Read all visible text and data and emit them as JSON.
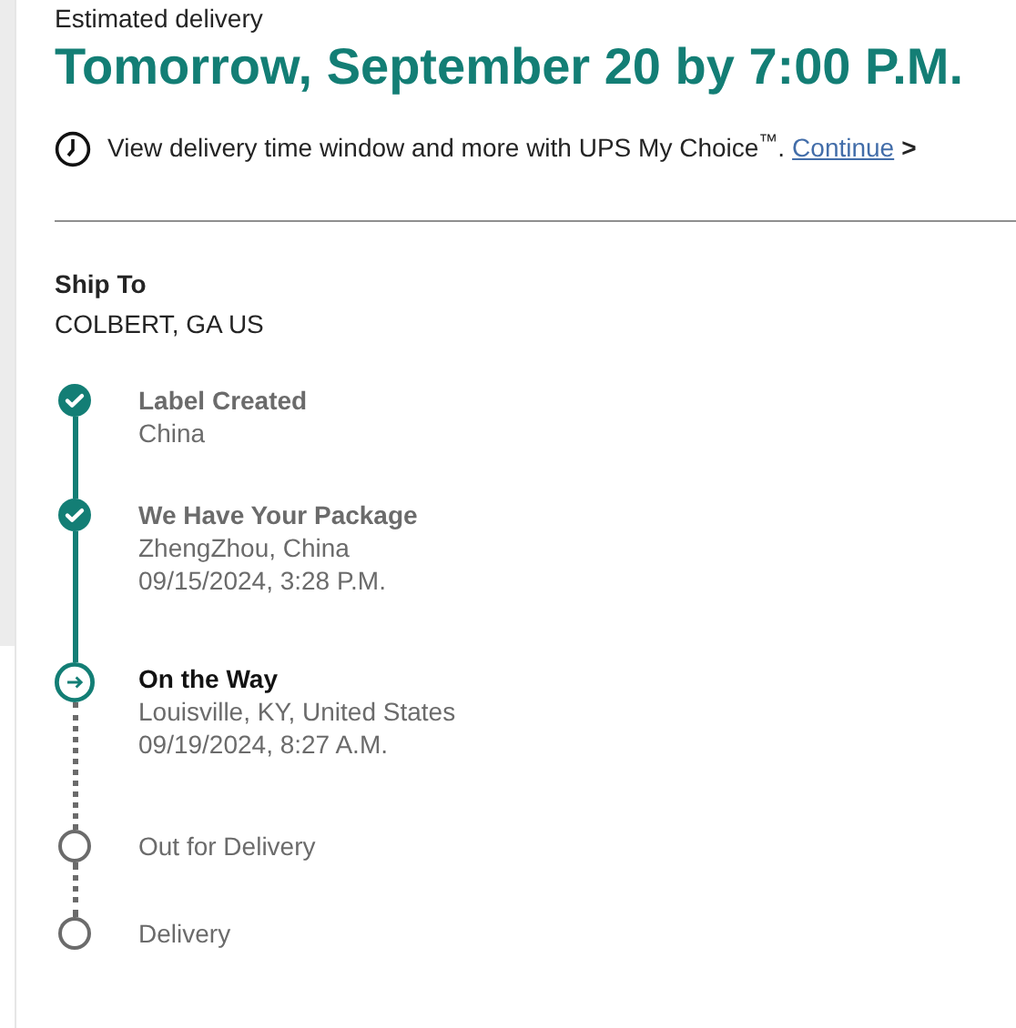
{
  "estimate": {
    "label": "Estimated delivery",
    "date": "Tomorrow, September 20 by 7:00 P.M."
  },
  "promo": {
    "text": "View delivery time window and more with UPS My Choice$^{™}$.",
    "link": "Continue",
    "arrow": ">"
  },
  "ship_to": {
    "label": "Ship To",
    "address": "COLBERT, GA US"
  },
  "steps": [
    {
      "kind": "done",
      "title": "Label Created",
      "lines": [
        "China"
      ]
    },
    {
      "kind": "done",
      "title": "We Have Your Package",
      "lines": [
        "ZhengZhou, China",
        "09/15/2024, 3:28 P.M."
      ]
    },
    {
      "kind": "current",
      "title": "On the Way",
      "lines": [
        "Louisville, KY, United States",
        "09/19/2024, 8:27 A.M."
      ]
    },
    {
      "kind": "pending",
      "title": "Out for Delivery"
    },
    {
      "kind": "pending",
      "title": "Delivery"
    }
  ]
}
